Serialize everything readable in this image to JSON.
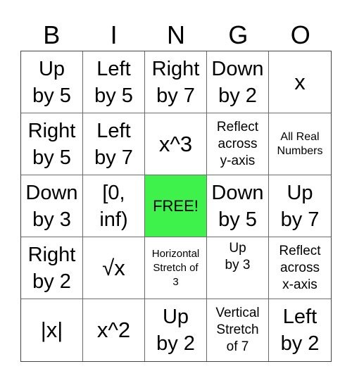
{
  "header": [
    "B",
    "I",
    "N",
    "G",
    "O"
  ],
  "free_color": "#3ef24b",
  "cells": [
    {
      "text": "Up\nby 5",
      "size": "fs-l"
    },
    {
      "text": "Left\nby 5",
      "size": "fs-l"
    },
    {
      "text": "Right\nby 7",
      "size": "fs-l"
    },
    {
      "text": "Down\nby 2",
      "size": "fs-l"
    },
    {
      "text": "x",
      "size": "fs-xl"
    },
    {
      "text": "Right\nby 5",
      "size": "fs-l"
    },
    {
      "text": "Left\nby 7",
      "size": "fs-l"
    },
    {
      "text": "x^3",
      "size": "fs-xl"
    },
    {
      "text": "Reflect\nacross\ny-axis",
      "size": "fs-s"
    },
    {
      "text": "All Real\nNumbers",
      "size": "fs-xs"
    },
    {
      "text": "Down\nby 3",
      "size": "fs-l"
    },
    {
      "text": "[0,\ninf)",
      "size": "fs-l"
    },
    {
      "text": "FREE!",
      "size": "fs-m",
      "free": true
    },
    {
      "text": "Down\nby 5",
      "size": "fs-l"
    },
    {
      "text": "Up\nby 7",
      "size": "fs-l"
    },
    {
      "text": "Right\nby 2",
      "size": "fs-l"
    },
    {
      "text": "√x",
      "size": "fs-xl"
    },
    {
      "text": "Horizontal\nStretch of\n3",
      "size": "fs-xxs"
    },
    {
      "text": "Up\nby 3",
      "size": "fs-s",
      "top": true
    },
    {
      "text": "Reflect\nacross\nx-axis",
      "size": "fs-s"
    },
    {
      "text": "|x|",
      "size": "fs-xl"
    },
    {
      "text": "x^2",
      "size": "fs-xl"
    },
    {
      "text": "Up\nby 2",
      "size": "fs-l"
    },
    {
      "text": "Vertical\nStretch\nof 7",
      "size": "fs-s"
    },
    {
      "text": "Left\nby 2",
      "size": "fs-l"
    }
  ]
}
